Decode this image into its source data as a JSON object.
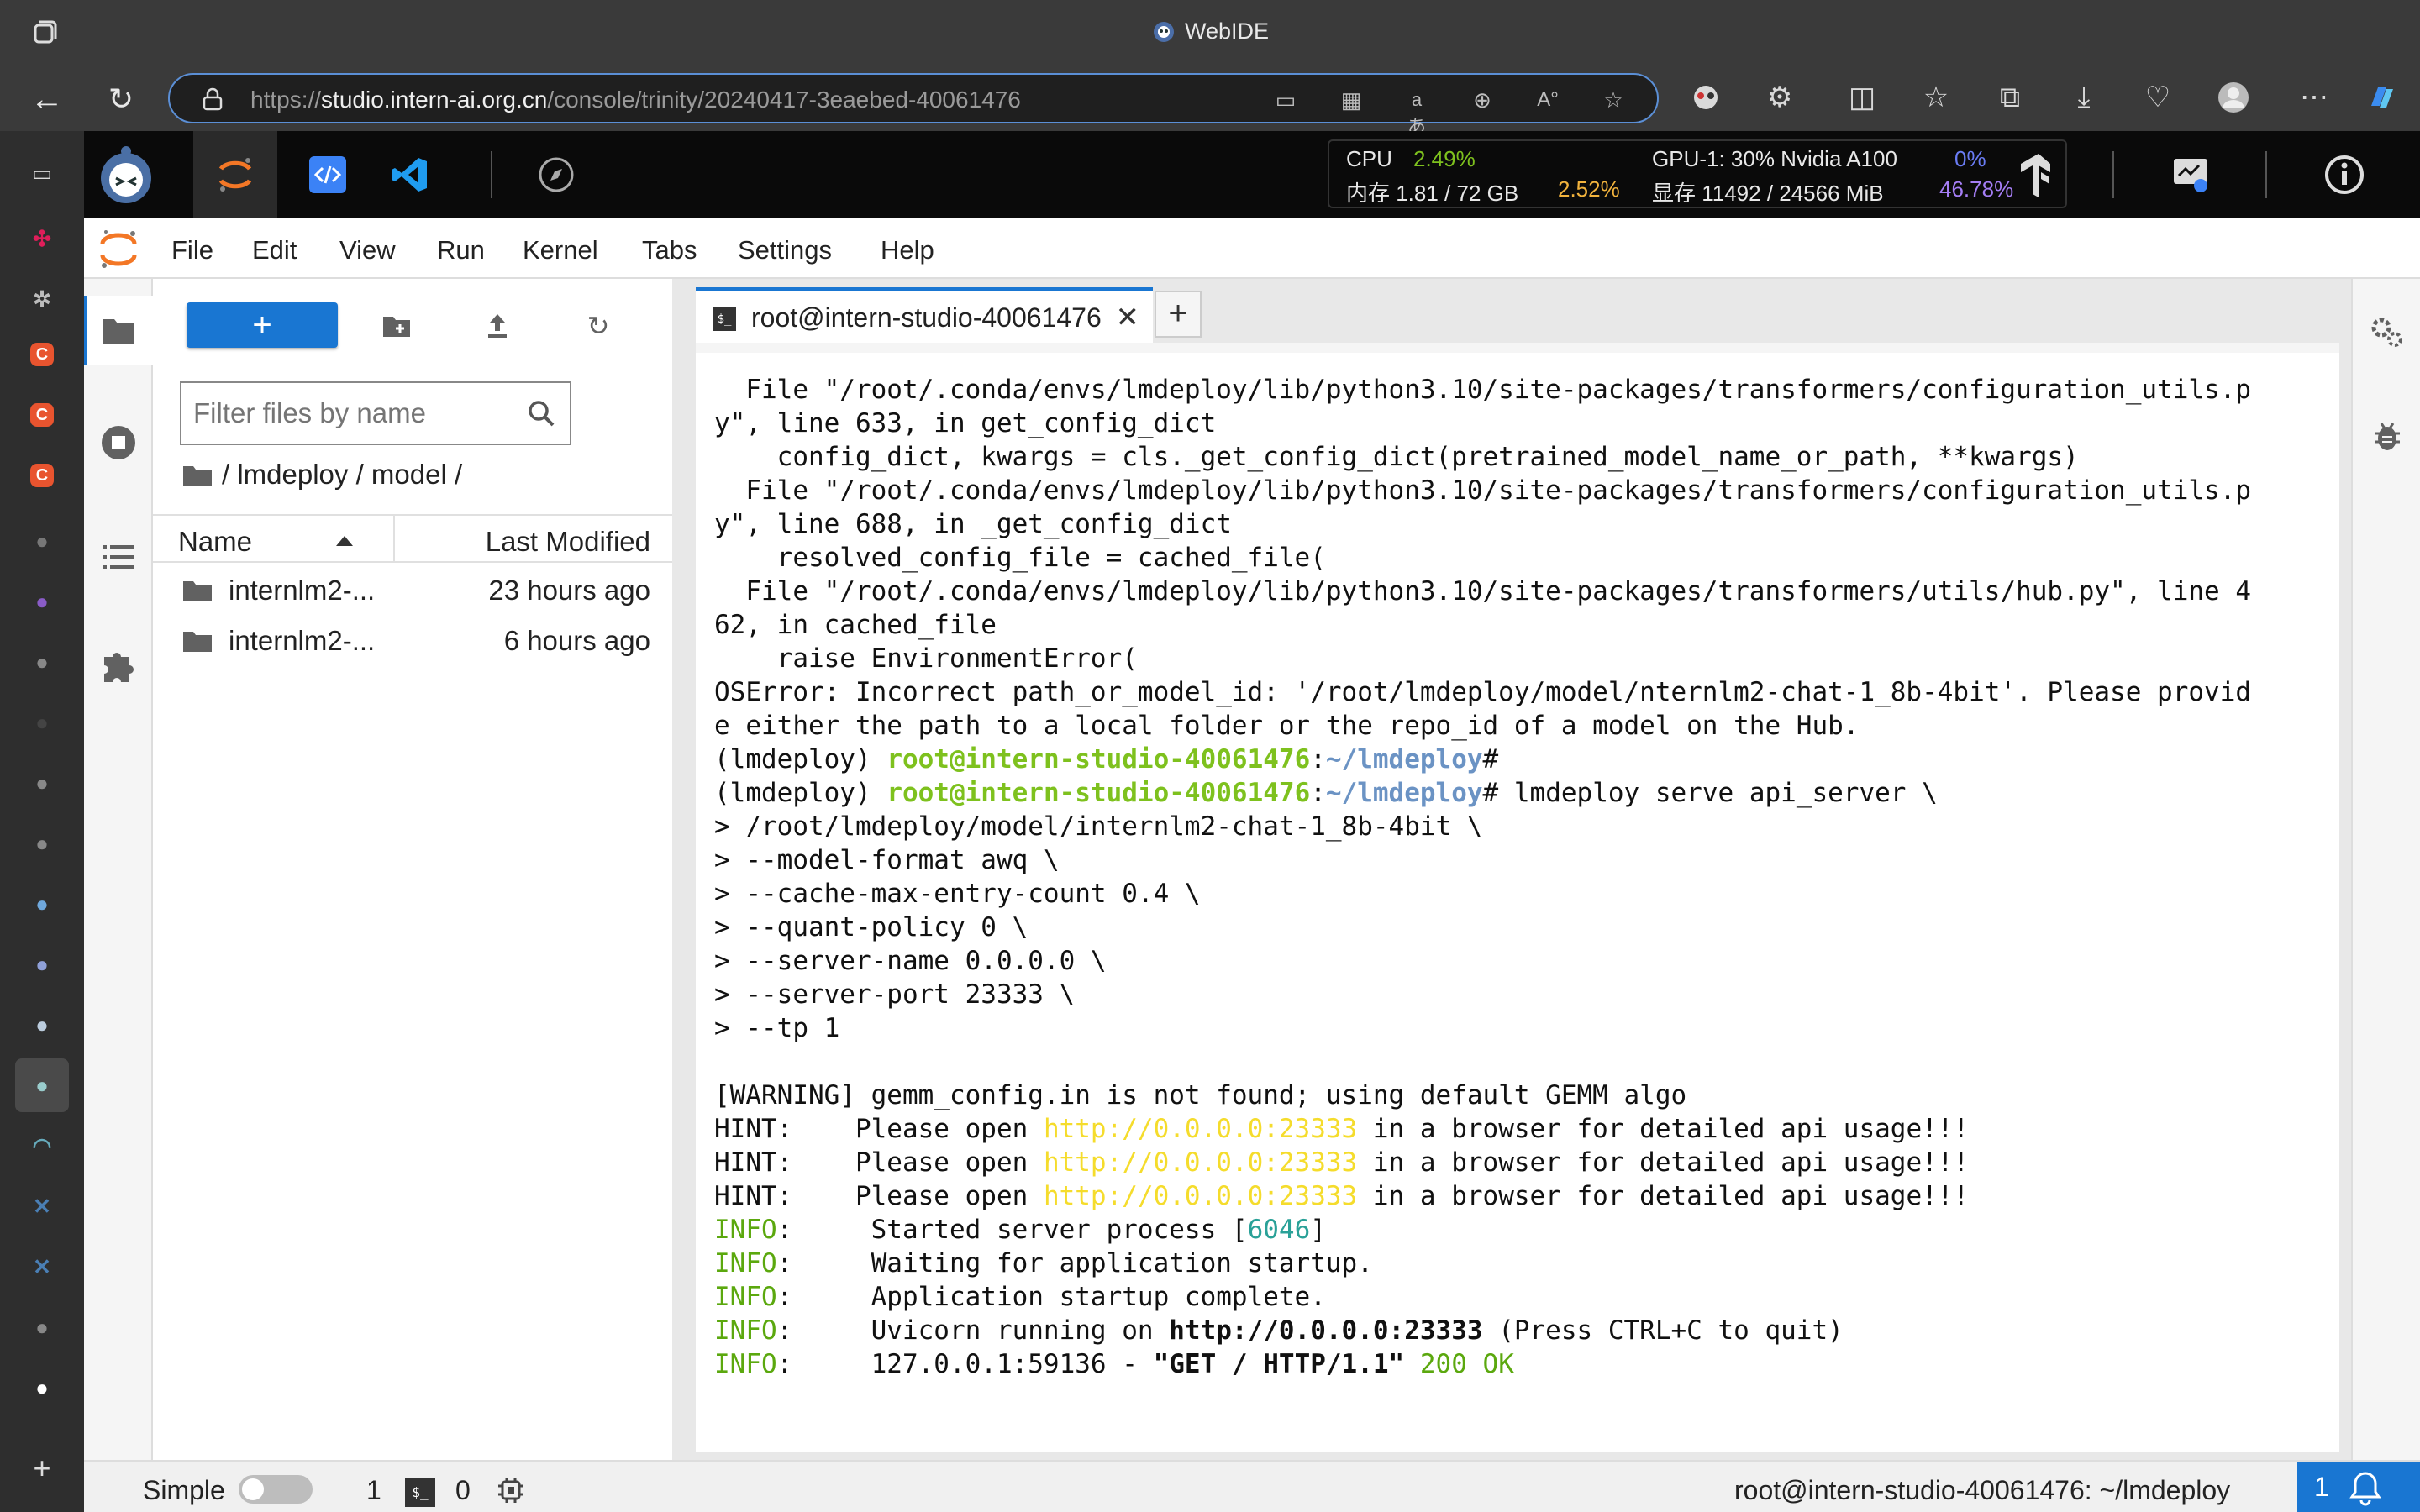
{
  "window": {
    "title": "WebIDE"
  },
  "browser": {
    "url_host_prefix": "https://",
    "url_host": "studio.intern-ai.org.cn",
    "url_path": "/console/trinity/20240417-3eaebed-40061476"
  },
  "stats": {
    "cpu_label": "CPU",
    "cpu_value": "2.49%",
    "mem_label": "内存 1.81 / 72 GB",
    "mem_value": "2.52%",
    "gpu_label": "GPU-1: 30% Nvidia A100",
    "gpu_value": "0%",
    "vram_label": "显存 11492 / 24566 MiB",
    "vram_value": "46.78%",
    "colors": {
      "cpu": "#7ec11e",
      "mem": "#f2b33d",
      "gpu": "#6a7cf4",
      "vram": "#a57ef5"
    }
  },
  "menu": [
    "File",
    "Edit",
    "View",
    "Run",
    "Kernel",
    "Tabs",
    "Settings",
    "Help"
  ],
  "file_browser": {
    "new_button": "+",
    "filter_placeholder": "Filter files by name",
    "breadcrumb": "/ lmdeploy / model /",
    "col_name": "Name",
    "col_modified": "Last Modified",
    "files": [
      {
        "name": "internlm2-...",
        "modified": "23 hours ago"
      },
      {
        "name": "internlm2-...",
        "modified": "6 hours ago"
      }
    ]
  },
  "tabs": [
    {
      "label": "root@intern-studio-40061476",
      "close": "✕"
    }
  ],
  "tab_add": "+",
  "terminal": {
    "lines": [
      [
        {
          "t": "  File \"/root/.conda/envs/lmdeploy/lib/python3.10/site-packages/transformers/configuration_utils.p"
        }
      ],
      [
        {
          "t": "y\", line 633, in get_config_dict"
        }
      ],
      [
        {
          "t": "    config_dict, kwargs = cls._get_config_dict(pretrained_model_name_or_path, **kwargs)"
        }
      ],
      [
        {
          "t": "  File \"/root/.conda/envs/lmdeploy/lib/python3.10/site-packages/transformers/configuration_utils.p"
        }
      ],
      [
        {
          "t": "y\", line 688, in _get_config_dict"
        }
      ],
      [
        {
          "t": "    resolved_config_file = cached_file("
        }
      ],
      [
        {
          "t": "  File \"/root/.conda/envs/lmdeploy/lib/python3.10/site-packages/transformers/utils/hub.py\", line 4"
        }
      ],
      [
        {
          "t": "62, in cached_file"
        }
      ],
      [
        {
          "t": "    raise EnvironmentError("
        }
      ],
      [
        {
          "t": "OSError: Incorrect path_or_model_id: '/root/lmdeploy/model/nternlm2-chat-1_8b-4bit'. Please provid"
        }
      ],
      [
        {
          "t": "e either the path to a local folder or the repo_id of a model on the Hub."
        }
      ],
      [
        {
          "t": "(lmdeploy) "
        },
        {
          "t": "root@intern-studio-40061476",
          "c": "t-green"
        },
        {
          "t": ":"
        },
        {
          "t": "~/lmdeploy",
          "c": "t-blue"
        },
        {
          "t": "#"
        }
      ],
      [
        {
          "t": "(lmdeploy) "
        },
        {
          "t": "root@intern-studio-40061476",
          "c": "t-green"
        },
        {
          "t": ":"
        },
        {
          "t": "~/lmdeploy",
          "c": "t-blue"
        },
        {
          "t": "# lmdeploy serve api_server \\"
        }
      ],
      [
        {
          "t": "> /root/lmdeploy/model/internlm2-chat-1_8b-4bit \\"
        }
      ],
      [
        {
          "t": "> --model-format awq \\"
        }
      ],
      [
        {
          "t": "> --cache-max-entry-count 0.4 \\"
        }
      ],
      [
        {
          "t": "> --quant-policy 0 \\"
        }
      ],
      [
        {
          "t": "> --server-name 0.0.0.0 \\"
        }
      ],
      [
        {
          "t": "> --server-port 23333 \\"
        }
      ],
      [
        {
          "t": "> --tp 1"
        }
      ],
      [
        {
          "t": ""
        }
      ],
      [
        {
          "t": "[WARNING] gemm_config.in is not found; using default GEMM algo"
        }
      ],
      [
        {
          "t": "HINT:    Please open "
        },
        {
          "t": "http://0.0.0.0:23333",
          "c": "t-yellow"
        },
        {
          "t": " in a browser for detailed api usage!!!"
        }
      ],
      [
        {
          "t": "HINT:    Please open "
        },
        {
          "t": "http://0.0.0.0:23333",
          "c": "t-yellow"
        },
        {
          "t": " in a browser for detailed api usage!!!"
        }
      ],
      [
        {
          "t": "HINT:    Please open "
        },
        {
          "t": "http://0.0.0.0:23333",
          "c": "t-yellow"
        },
        {
          "t": " in a browser for detailed api usage!!!"
        }
      ],
      [
        {
          "t": "INFO",
          "c": "t-info"
        },
        {
          "t": ":     Started server process ["
        },
        {
          "t": "6046",
          "c": "t-teal"
        },
        {
          "t": "]"
        }
      ],
      [
        {
          "t": "INFO",
          "c": "t-info"
        },
        {
          "t": ":     Waiting for application startup."
        }
      ],
      [
        {
          "t": "INFO",
          "c": "t-info"
        },
        {
          "t": ":     Application startup complete."
        }
      ],
      [
        {
          "t": "INFO",
          "c": "t-info"
        },
        {
          "t": ":     Uvicorn running on "
        },
        {
          "t": "http://0.0.0.0:23333",
          "c": "t-bold"
        },
        {
          "t": " (Press CTRL+C to quit)"
        }
      ],
      [
        {
          "t": "INFO",
          "c": "t-info"
        },
        {
          "t": ":     127.0.0.1:59136 - "
        },
        {
          "t": "\"GET / HTTP/1.1\"",
          "c": "t-bold"
        },
        {
          "t": " "
        },
        {
          "t": "200 OK",
          "c": "t-info"
        }
      ]
    ]
  },
  "statusbar": {
    "mode": "Simple",
    "count1": "1",
    "count2": "0",
    "right_text": "root@intern-studio-40061476: ~/lmdeploy",
    "notifications": "1"
  }
}
